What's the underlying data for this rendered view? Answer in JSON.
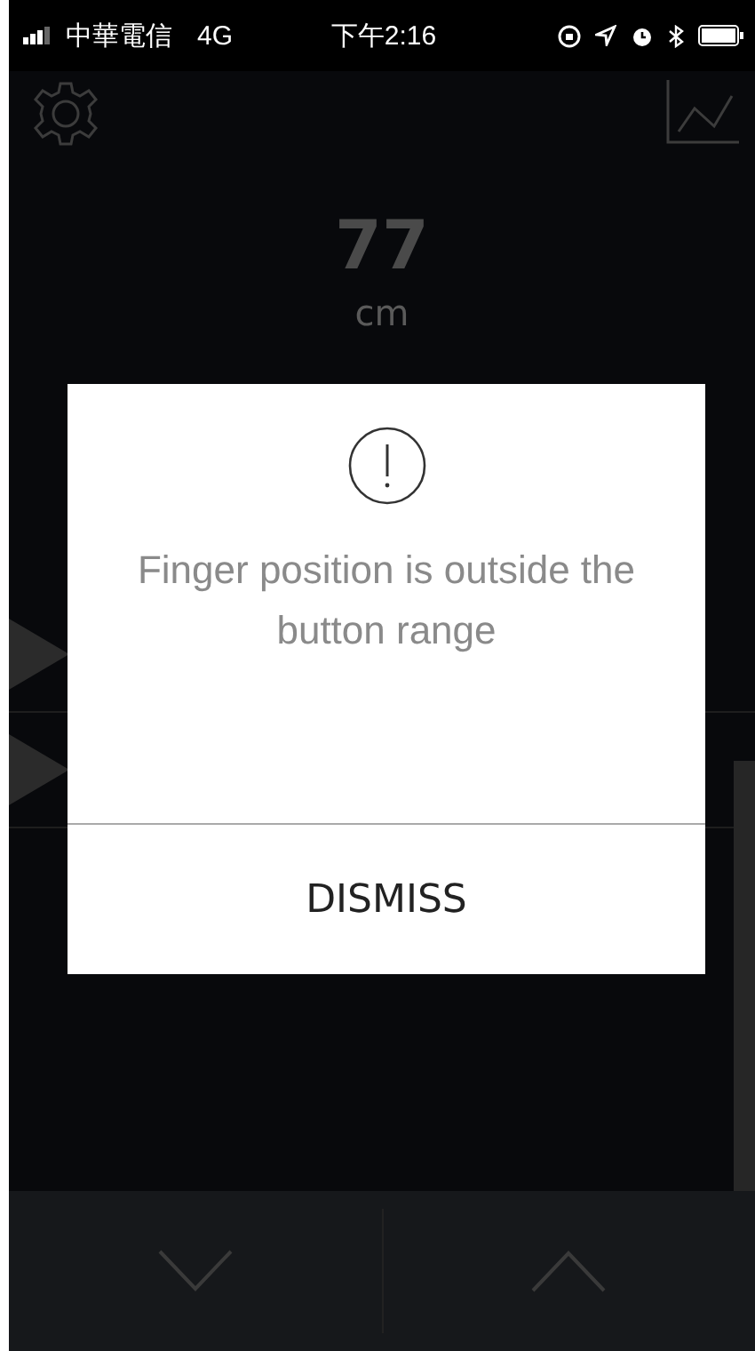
{
  "status_bar": {
    "carrier": "中華電信",
    "network": "4G",
    "time": "下午2:16"
  },
  "reading": {
    "value": "77",
    "unit": "cm"
  },
  "alert": {
    "message": "Finger position is outside the button range",
    "button": "DISMISS"
  }
}
